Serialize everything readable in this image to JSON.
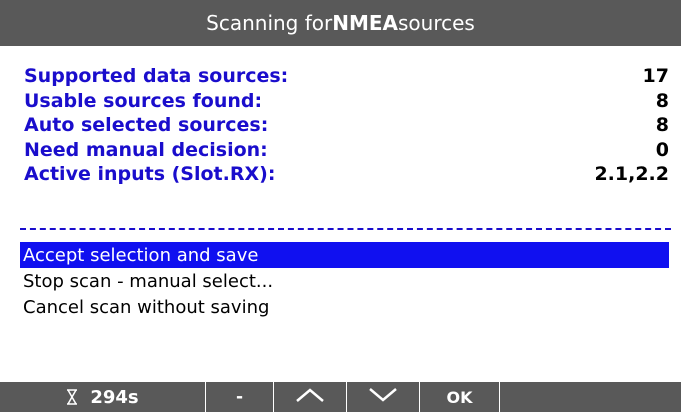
{
  "colors": {
    "title_bar": "#595959",
    "label_blue": "#1a0dcc",
    "selection_blue": "#1010f0",
    "softkey_bar": "#595959"
  },
  "title": {
    "prefix": "Scanning for ",
    "bold": "NMEA",
    "suffix": " sources"
  },
  "stats": [
    {
      "label": "Supported data sources:",
      "value": "17"
    },
    {
      "label": "Usable sources found:",
      "value": "8"
    },
    {
      "label": "Auto selected sources:",
      "value": "8"
    },
    {
      "label": "Need manual decision:",
      "value": "0"
    },
    {
      "label": "Active inputs (Slot.RX):",
      "value": "2.1,2.2"
    }
  ],
  "menu": {
    "selected_index": 0,
    "items": [
      {
        "label": "Accept selection and save"
      },
      {
        "label": "Stop scan - manual select..."
      },
      {
        "label": "Cancel scan without saving"
      }
    ]
  },
  "softkeys": {
    "timer_icon": "hourglass-icon",
    "timer": "294s",
    "minus": "-",
    "up_icon": "chevron-up-icon",
    "down_icon": "chevron-down-icon",
    "ok": "OK",
    "empty": ""
  }
}
